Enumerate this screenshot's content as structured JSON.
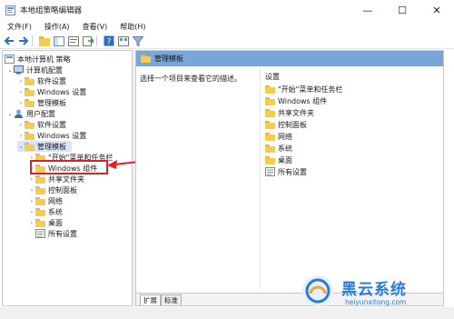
{
  "window": {
    "title": "本地组策略编辑器"
  },
  "menu": [
    "文件(F)",
    "操作(A)",
    "查看(V)",
    "帮助(H)"
  ],
  "tree": {
    "root": "本地计算机 策略",
    "computer_config": "计算机配置",
    "computer_children": [
      "软件设置",
      "Windows 设置",
      "管理模板"
    ],
    "user_config": "用户配置",
    "user_children": [
      "软件设置",
      "Windows 设置",
      "管理模板"
    ],
    "admin_templates_children": [
      "\"开始\"菜单和任务栏",
      "Windows 组件",
      "共享文件夹",
      "控制面板",
      "网络",
      "系统",
      "桌面",
      "所有设置"
    ]
  },
  "right": {
    "header": "管理模板",
    "description": "选择一个项目来查看它的描述。",
    "list_header": "设置",
    "items": [
      "\"开始\"菜单和任务栏",
      "Windows 组件",
      "共享文件夹",
      "控制面板",
      "网络",
      "系统",
      "桌面",
      "所有设置"
    ],
    "tabs": [
      "扩展",
      "标准"
    ]
  },
  "watermark": {
    "name": "黑云系统",
    "url": "heiyunxitong.com"
  },
  "colors": {
    "header": "#7aa5d8",
    "selection": "#d6e6f8",
    "highlight": "#e02020",
    "folder": "#f4cc52",
    "watermark": "#2a7bd6"
  }
}
